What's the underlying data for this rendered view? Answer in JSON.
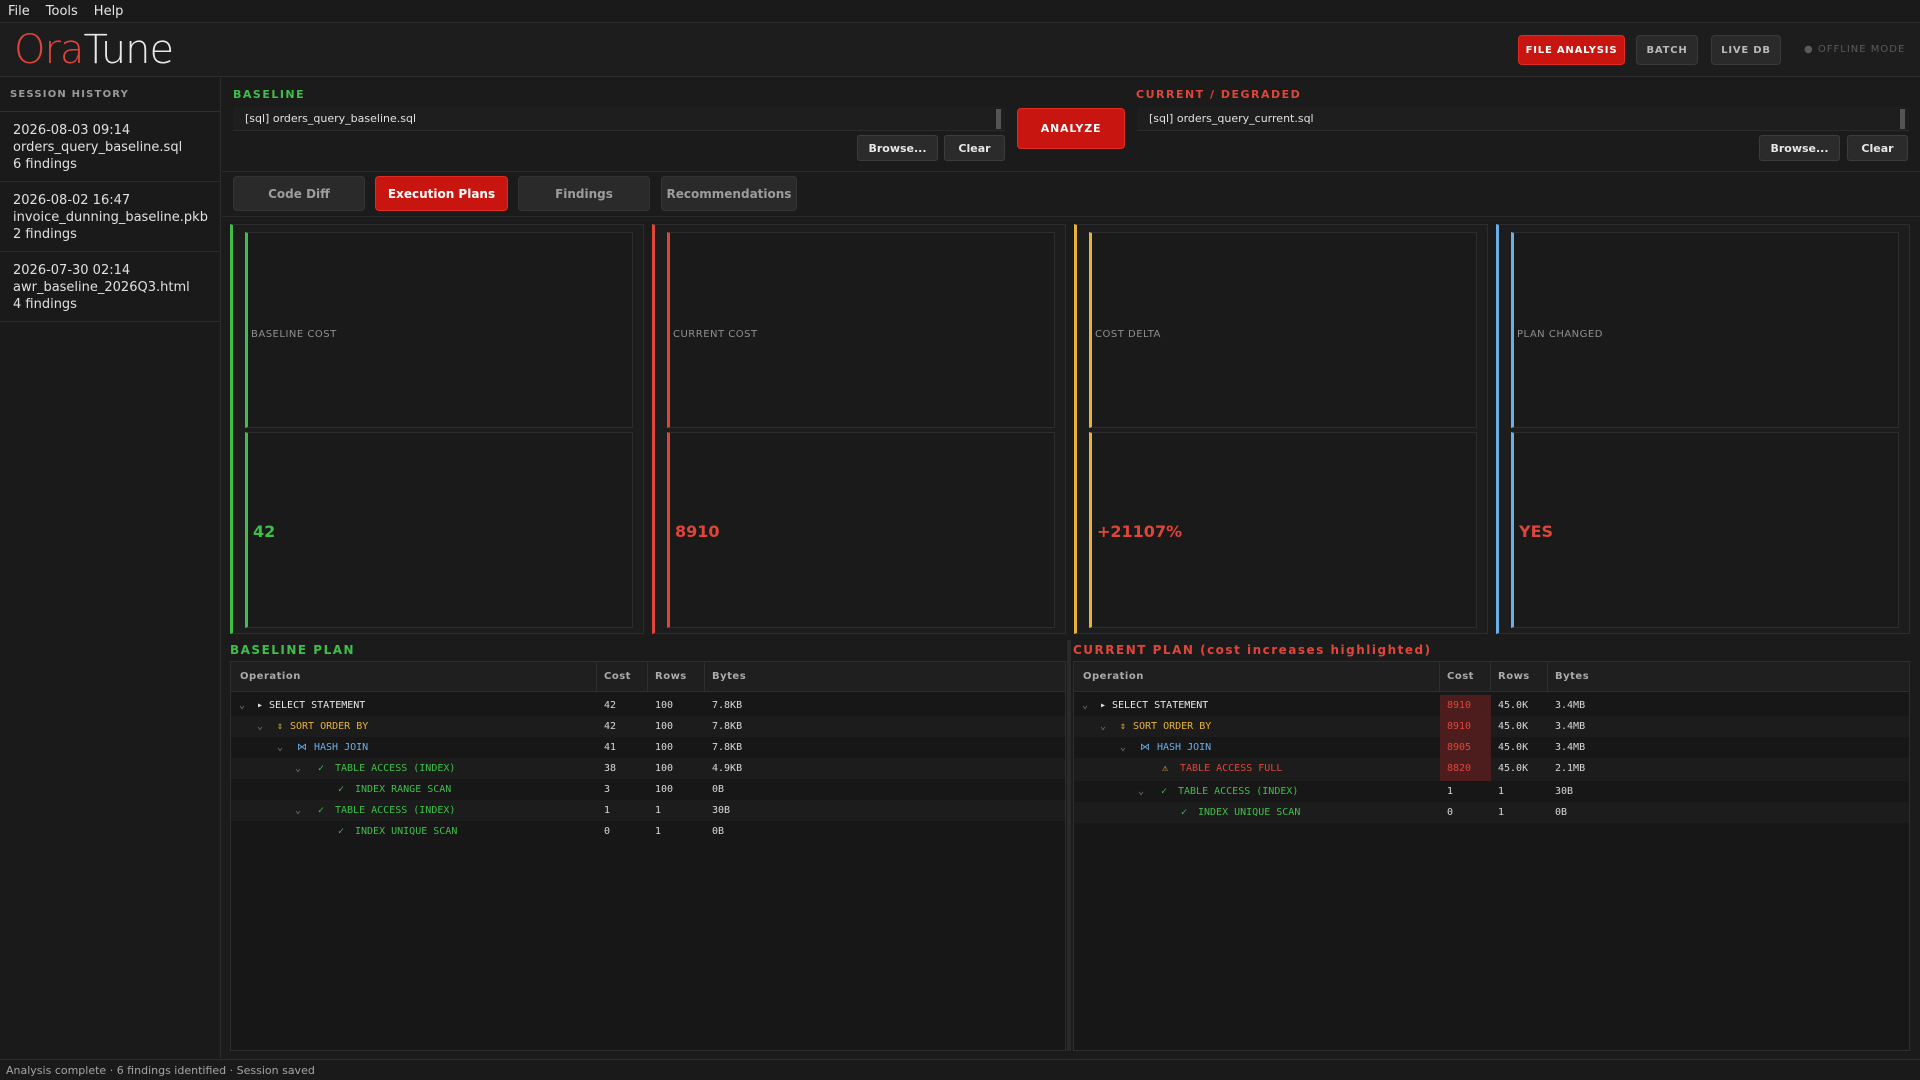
{
  "menu": [
    "File",
    "Tools",
    "Help"
  ],
  "app": {
    "logo_part1": "Ora",
    "logo_part2": "Tune"
  },
  "modes": {
    "file_analysis": "FILE ANALYSIS",
    "batch": "BATCH",
    "live_db": "LIVE DB",
    "offline": "● OFFLINE MODE"
  },
  "sidebar": {
    "title": "SESSION HISTORY",
    "items": [
      {
        "time": "2026-08-03 09:14",
        "file": "orders_query_baseline.sql",
        "findings": "6 findings"
      },
      {
        "time": "2026-08-02 16:47",
        "file": "invoice_dunning_baseline.pkb",
        "findings": "2 findings"
      },
      {
        "time": "2026-07-30 02:14",
        "file": "awr_baseline_2026Q3.html",
        "findings": "4 findings"
      }
    ]
  },
  "baseline": {
    "label": "BASELINE",
    "file": "[sql] orders_query_baseline.sql",
    "browse": "Browse...",
    "clear": "Clear"
  },
  "current": {
    "label": "CURRENT / DEGRADED",
    "file": "[sql] orders_query_current.sql",
    "browse": "Browse...",
    "clear": "Clear"
  },
  "analyze_label": "ANALYZE",
  "tabs": [
    "Code Diff",
    "Execution Plans",
    "Findings",
    "Recommendations"
  ],
  "metrics": [
    {
      "label": "BASELINE COST",
      "value": "42",
      "color": "#3fbf4a"
    },
    {
      "label": "CURRENT COST",
      "value": "8910",
      "color": "#e0453a"
    },
    {
      "label": "COST DELTA",
      "value": "+21107%",
      "color": "#e0453a",
      "accent": "#e6b23a"
    },
    {
      "label": "PLAN CHANGED",
      "value": "YES",
      "color": "#e0453a",
      "accent": "#6aaee8"
    }
  ],
  "plans": {
    "headers": {
      "operation": "Operation",
      "cost": "Cost",
      "rows": "Rows",
      "bytes": "Bytes"
    },
    "baseline": {
      "title": "BASELINE PLAN",
      "rows": [
        {
          "icon": "▸",
          "op": "SELECT STATEMENT",
          "cost": "42",
          "rows": "100",
          "bytes": "7.8KB"
        },
        {
          "icon": "⇕",
          "op": "SORT ORDER BY",
          "cost": "42",
          "rows": "100",
          "bytes": "7.8KB"
        },
        {
          "icon": "⋈",
          "op": "HASH JOIN",
          "cost": "41",
          "rows": "100",
          "bytes": "7.8KB"
        },
        {
          "icon": "✓",
          "op": "TABLE ACCESS (INDEX)",
          "cost": "38",
          "rows": "100",
          "bytes": "4.9KB"
        },
        {
          "icon": "✓",
          "op": "INDEX RANGE SCAN",
          "cost": "3",
          "rows": "100",
          "bytes": "0B"
        },
        {
          "icon": "✓",
          "op": "TABLE ACCESS (INDEX)",
          "cost": "1",
          "rows": "1",
          "bytes": "30B"
        },
        {
          "icon": "✓",
          "op": "INDEX UNIQUE SCAN",
          "cost": "0",
          "rows": "1",
          "bytes": "0B"
        }
      ]
    },
    "current": {
      "title": "CURRENT PLAN  (cost increases highlighted)",
      "rows": [
        {
          "icon": "▸",
          "op": "SELECT STATEMENT",
          "cost": "8910",
          "rows": "45.0K",
          "bytes": "3.4MB"
        },
        {
          "icon": "⇕",
          "op": "SORT ORDER BY",
          "cost": "8910",
          "rows": "45.0K",
          "bytes": "3.4MB"
        },
        {
          "icon": "⋈",
          "op": "HASH JOIN",
          "cost": "8905",
          "rows": "45.0K",
          "bytes": "3.4MB"
        },
        {
          "icon": "⚠",
          "op": "TABLE ACCESS FULL",
          "cost": "8820",
          "rows": "45.0K",
          "bytes": "2.1MB"
        },
        {
          "icon": "✓",
          "op": "TABLE ACCESS (INDEX)",
          "cost": "1",
          "rows": "1",
          "bytes": "30B"
        },
        {
          "icon": "✓",
          "op": "INDEX UNIQUE SCAN",
          "cost": "0",
          "rows": "1",
          "bytes": "0B"
        }
      ]
    }
  },
  "status": "Analysis complete  ·  6 findings identified  ·  Session saved"
}
